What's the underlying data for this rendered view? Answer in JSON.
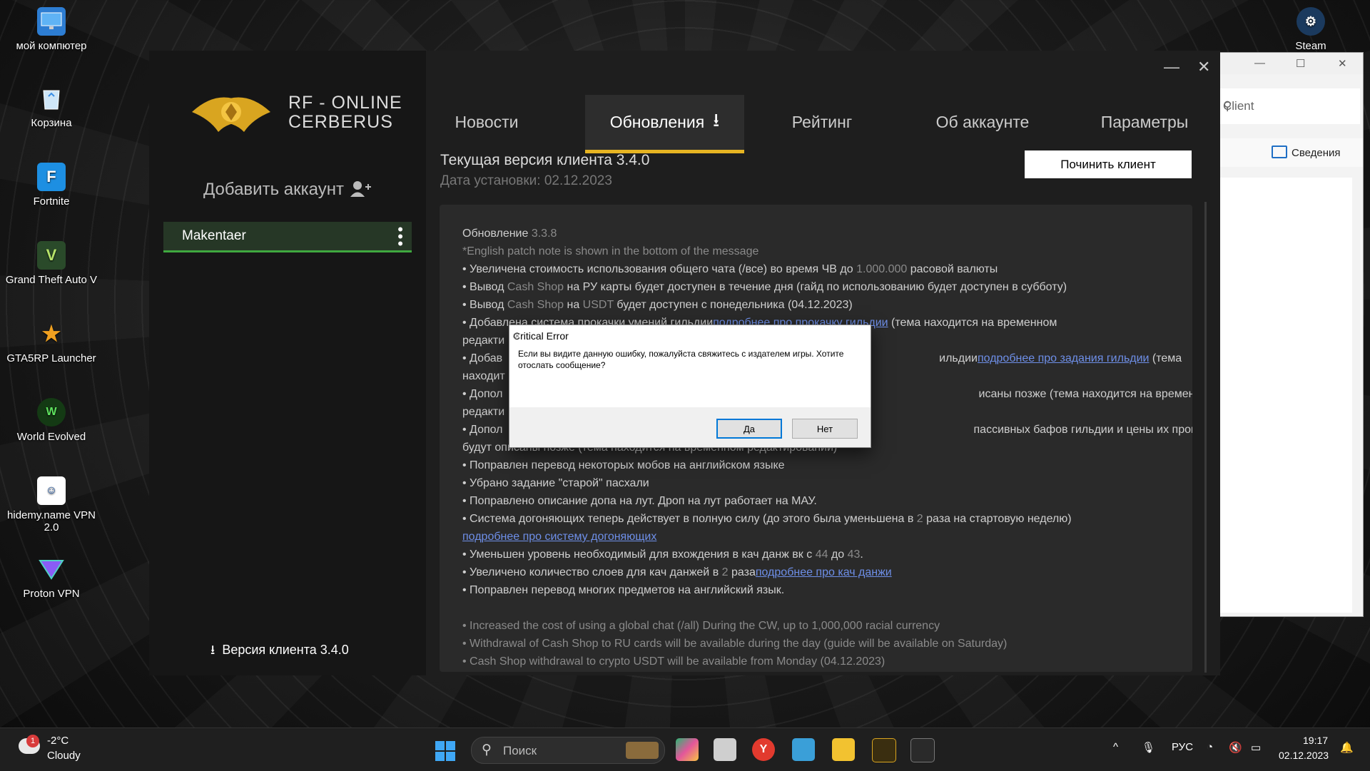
{
  "desktop_icons": [
    {
      "label": "мой компютер",
      "icon": "monitor-icon"
    },
    {
      "label": "Корзина",
      "icon": "recycle-bin-icon"
    },
    {
      "label": "Fortnite",
      "icon": "fortnite-icon"
    },
    {
      "label": "Grand Theft Auto V",
      "icon": "gta-v-icon"
    },
    {
      "label": "GTA5RP Launcher",
      "icon": "gta5rp-icon"
    },
    {
      "label": "World Evolved",
      "icon": "world-evolved-icon"
    },
    {
      "label": "hidemy.name VPN 2.0",
      "icon": "hidemy-vpn-icon"
    },
    {
      "label": "Proton VPN",
      "icon": "proton-vpn-icon"
    },
    {
      "label": "Steam",
      "icon": "steam-icon"
    }
  ],
  "launcher": {
    "logo_text_line1": "RF - ONLINE",
    "logo_text_line2": "CERBERUS",
    "tabs": [
      {
        "label": "Новости"
      },
      {
        "label": "Обновления"
      },
      {
        "label": "Рейтинг"
      },
      {
        "label": "Об аккаунте"
      },
      {
        "label": "Параметры"
      }
    ],
    "active_tab": "Обновления",
    "accent_color": "#e6b422",
    "add_account": "Добавить аккаунт",
    "account_name": "Makentaer",
    "version_label": "Версия клиента 3.4.0",
    "current_version": "Текущая версия клиента 3.4.0",
    "install_date": "Дата установки: 02.12.2023",
    "repair_button": "Починить клиент",
    "notes": {
      "title_prefix": "Обновление ",
      "title_version": "3.3.8",
      "english_note": "*English patch note is shown in the bottom of the message",
      "l1_a": "• Увеличена стоимость использования общего чата (/все) во время ЧВ до ",
      "l1_b": "1.000.000",
      "l1_c": " расовой валюты",
      "l2_a": "• Вывод ",
      "l2_b": "Cash Shop",
      "l2_c": " на РУ карты будет доступен в течение дня (гайд по использованию будет доступен в субботу)",
      "l3_a": "• Вывод ",
      "l3_b": "Cash Shop",
      "l3_c": " на ",
      "l3_d": "USDT",
      "l3_e": " будет доступен с понедельника (04.12.2023)",
      "l4_a": "• Добавлена система прокачки умений гильдии",
      "l4_link": "подробнее про прокачку гильдии",
      "l4_c": " (тема находится на временном",
      "l5": "редакти",
      "l6_a": "• Добав",
      "l6_b": "ильдии",
      "l6_link": "подробнее про задания гильдии",
      "l6_c": " (тема",
      "l7": "находит",
      "l8_a": "• Допол",
      "l8_b": "исаны позже (тема находится на временном",
      "l9": "редакти",
      "l10_a": "• Допол",
      "l10_b": "пассивных бафов гильдии и цены их прокачки",
      "l11": "будут описаны позже (тема находится на временном редактировании)",
      "l12": "• Поправлен перевод некоторых мобов на английском языке",
      "l13": "• Убрано задание \"старой\" пасхали",
      "l14": "• Поправлено описание допа на лут. Дроп на лут работает на МАУ.",
      "l15_a": "• Система догоняющих теперь действует в полную силу (до этого была уменьшена в ",
      "l15_b": "2",
      "l15_c": " раза на стартовую неделю)",
      "l16_link": "подробнее про систему догоняющих",
      "l17_a": "• Уменьшен уровень необходимый для вхождения в кач данж вк с ",
      "l17_b": "44",
      "l17_c": " до ",
      "l17_d": "43",
      "l17_e": ".",
      "l18_a": "• Увеличено количество слоев для кач данжей в ",
      "l18_b": "2",
      "l18_c": " раза",
      "l18_link": "подробнее про кач данжи",
      "l19": "• Поправлен перевод многих предметов на английский язык.",
      "e1": "• Increased the cost of using a global chat (/all) During the CW, up to 1,000,000 racial currency",
      "e2": "• Withdrawal of Cash Shop to RU cards will be available during the day (guide will be available on Saturday)",
      "e3": "• Cash Shop withdrawal to crypto USDT will be available from Monday (04.12.2023)"
    }
  },
  "dialog": {
    "title": "Critical Error",
    "message": "Если вы видите данную ошибку, пожалуйста свяжитесь с издателем игры. Хотите отослать сообщение?",
    "yes": "Да",
    "no": "Нет"
  },
  "explorer": {
    "search_text": "Client",
    "details_label": "Сведения"
  },
  "taskbar": {
    "weather_badge": "1",
    "temperature": "-2°C",
    "condition": "Cloudy",
    "search_placeholder": "Поиск",
    "language": "РУС",
    "time": "19:17",
    "date": "02.12.2023"
  }
}
